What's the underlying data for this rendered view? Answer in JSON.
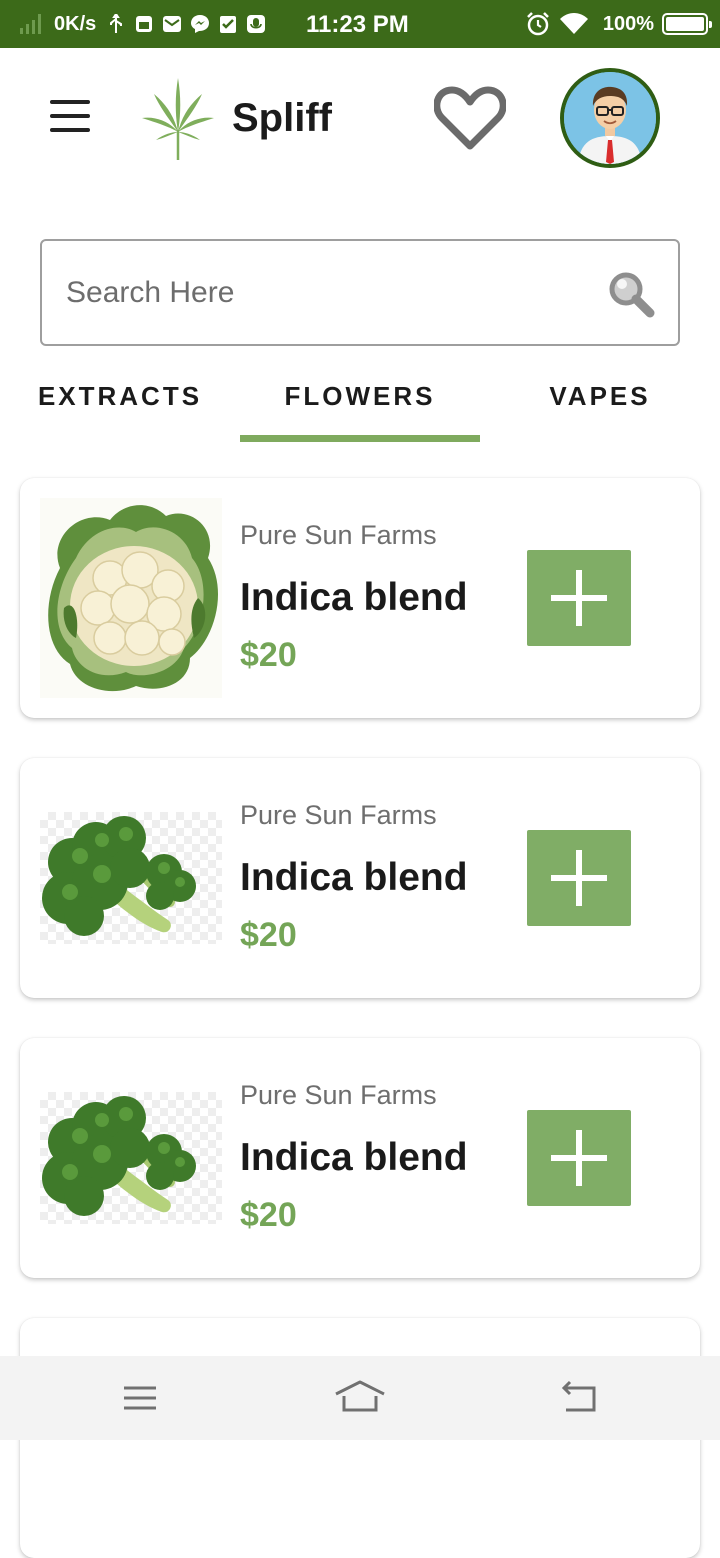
{
  "status_bar": {
    "net_speed": "0K/s",
    "time": "11:23 PM",
    "battery_pct": "100%",
    "bg_color": "#3c6a19",
    "icons": [
      "signal-icon",
      "usb-icon",
      "sim-icon",
      "mail-icon",
      "messenger-icon",
      "clipboard-icon",
      "mic-icon",
      "alarm-icon",
      "wifi-icon",
      "battery-icon"
    ]
  },
  "header": {
    "title": "Spliff",
    "icons": [
      "menu-icon",
      "cannabis-leaf-logo",
      "heart-icon",
      "profile-avatar"
    ]
  },
  "search": {
    "placeholder": "Search Here",
    "value": ""
  },
  "tabs": [
    {
      "label": "EXTRACTS",
      "active": false
    },
    {
      "label": "FLOWERS",
      "active": true
    },
    {
      "label": "VAPES",
      "active": false
    }
  ],
  "products": [
    {
      "vendor": "Pure Sun Farms",
      "name": "Indica blend",
      "price": "$20",
      "image": "cauliflower-image"
    },
    {
      "vendor": "Pure Sun Farms",
      "name": "Indica blend",
      "price": "$20",
      "image": "broccoli-image"
    },
    {
      "vendor": "Pure Sun Farms",
      "name": "Indica blend",
      "price": "$20",
      "image": "broccoli-image"
    }
  ],
  "colors": {
    "accent": "#7faa5e",
    "price": "#74a557",
    "add_button": "#80ad66"
  },
  "system_nav": {
    "icons": [
      "recents-icon",
      "home-icon",
      "back-icon"
    ]
  }
}
